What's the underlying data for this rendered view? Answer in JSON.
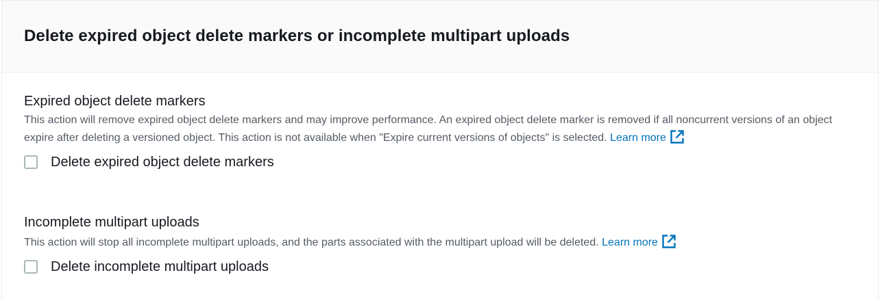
{
  "panel": {
    "title": "Delete expired object delete markers or incomplete multipart uploads"
  },
  "expired_markers": {
    "label": "Expired object delete markers",
    "description": "This action will remove expired object delete markers and may improve performance. An expired object delete marker is removed if all noncurrent versions of an object expire after deleting a versioned object. This action is not available when \"Expire current versions of objects\" is selected.",
    "learn_more": "Learn more",
    "learn_more_icon": "external-link-icon",
    "checkbox_label": "Delete expired object delete markers",
    "checked": false
  },
  "incomplete_uploads": {
    "label": "Incomplete multipart uploads",
    "description": "This action will stop all incomplete multipart uploads, and the parts associated with the multipart upload will be deleted.",
    "learn_more": "Learn more",
    "learn_more_icon": "external-link-icon",
    "checkbox_label": "Delete incomplete multipart uploads",
    "checked": false
  },
  "colors": {
    "link": "#0073bb",
    "text": "#16191f",
    "secondary_text": "#545b64",
    "header_background": "#fafafa",
    "checkbox_border": "#aab7b8"
  }
}
